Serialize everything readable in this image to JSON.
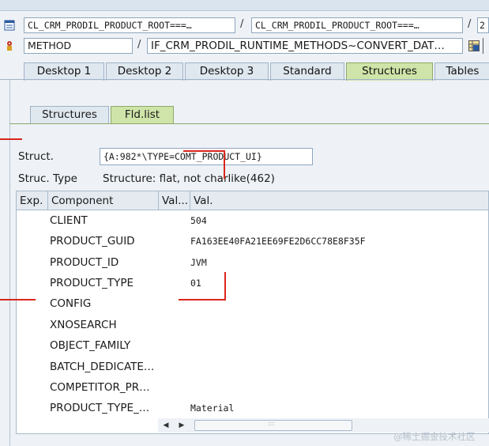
{
  "row1": {
    "field1": "CL_CRM_PRODIL_PRODUCT_ROOT===…",
    "sep1": "/",
    "field2": "CL_CRM_PRODIL_PRODUCT_ROOT===…",
    "sep2": "/",
    "field3": "2"
  },
  "row2": {
    "field1": "METHOD",
    "sep": "/",
    "field2": "IF_CRM_PRODIL_RUNTIME_METHODS~CONVERT_DAT…"
  },
  "tabs": [
    "Desktop 1",
    "Desktop 2",
    "Desktop 3",
    "Standard",
    "Structures",
    "Tables"
  ],
  "subtabs": [
    "Structures",
    "Fld.list"
  ],
  "struct": {
    "label": "Struct.",
    "value": "{A:982*\\TYPE=COMT_PRODUCT_UI}",
    "type_label": "Struc. Type",
    "type_value": "Structure: flat, not charlike(462)"
  },
  "table": {
    "headers": [
      "Exp.",
      "Component",
      "Val...",
      "Val."
    ],
    "rows": [
      {
        "component": "CLIENT",
        "value": "504"
      },
      {
        "component": "PRODUCT_GUID",
        "value": "FA163EE40FA21EE69FE2D6CC78E8F35F"
      },
      {
        "component": "PRODUCT_ID",
        "value": "JVM"
      },
      {
        "component": "PRODUCT_TYPE",
        "value": "01"
      },
      {
        "component": "CONFIG",
        "value": ""
      },
      {
        "component": "XNOSEARCH",
        "value": ""
      },
      {
        "component": "OBJECT_FAMILY",
        "value": ""
      },
      {
        "component": "BATCH_DEDICATE…",
        "value": ""
      },
      {
        "component": "COMPETITOR_PR…",
        "value": ""
      },
      {
        "component": "PRODUCT_TYPE_…",
        "value": "Material"
      }
    ]
  },
  "scroll": {
    "left": "◀",
    "right": "▶",
    "grip": ":::"
  },
  "watermark": "@稀土掘金技术社区",
  "colors": {
    "accent_tab": "#cfe4a8",
    "annotation": "#d9261c"
  }
}
